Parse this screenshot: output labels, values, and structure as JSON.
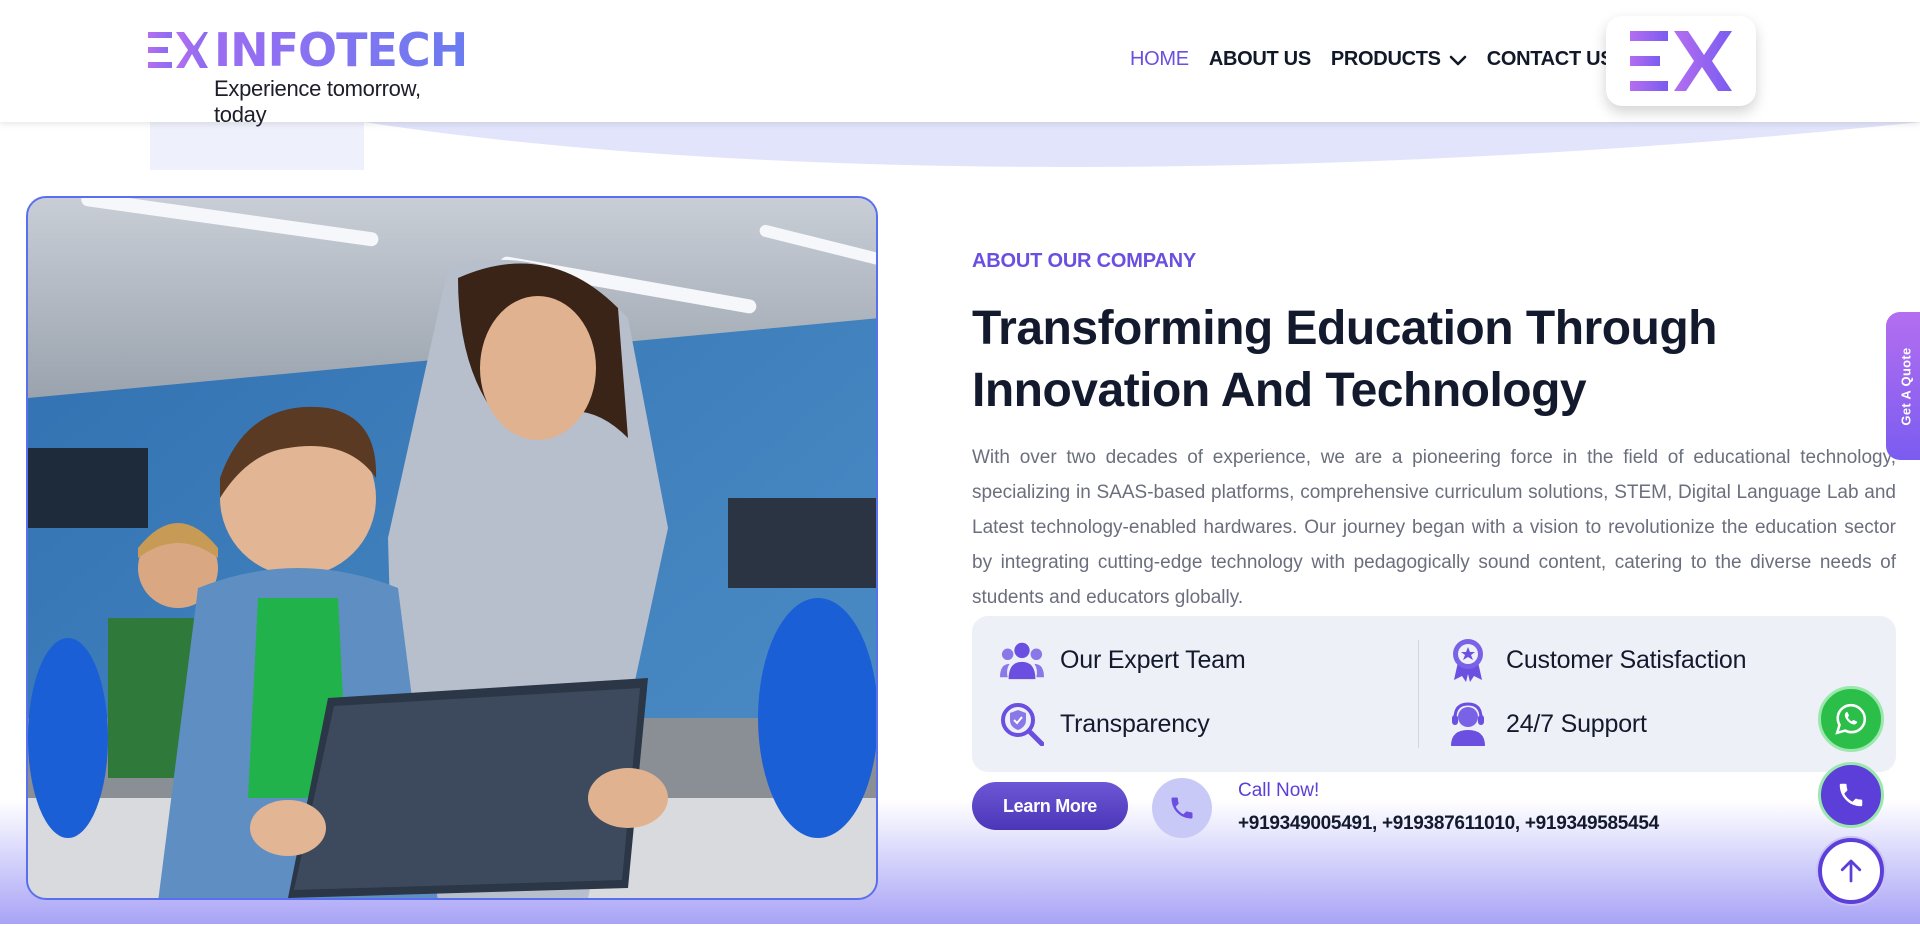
{
  "brand": {
    "name": "INFOTECH",
    "tagline": "Experience tomorrow, today",
    "colors": {
      "primary": "#6a4fe0",
      "accent_gradient_start": "#b46ef0",
      "accent_gradient_end": "#6a7cf0",
      "dark": "#141a2e"
    }
  },
  "nav": {
    "items": [
      {
        "label": "HOME",
        "active": true
      },
      {
        "label": "ABOUT US",
        "active": false
      },
      {
        "label": "PRODUCTS",
        "active": false,
        "has_dropdown": true
      },
      {
        "label": "CONTACT US",
        "active": false
      }
    ]
  },
  "about": {
    "eyebrow": "ABOUT OUR COMPANY",
    "headline_line1": "Transforming Education Through",
    "headline_line2": "Innovation And Technology",
    "paragraph": "With over two decades of experience, we are a pioneering force in the field of educational technology, specializing in SAAS-based platforms, comprehensive curriculum solutions, STEM, Digital Language Lab and Latest technology-enabled hardwares. Our journey began with a vision to revolutionize the education sector by integrating cutting-edge technology with pedagogically sound content, catering to the diverse needs of students and educators globally.",
    "features": [
      {
        "label": "Our Expert Team",
        "icon": "team-icon"
      },
      {
        "label": "Customer Satisfaction",
        "icon": "award-ribbon-icon"
      },
      {
        "label": "Transparency",
        "icon": "shield-search-icon"
      },
      {
        "label": "24/7 Support",
        "icon": "support-agent-icon"
      }
    ],
    "learn_more_label": "Learn More",
    "call_label": "Call Now!",
    "call_numbers": "+919349005491, +919387611010, +919349585454"
  },
  "side_tab": {
    "label": "Get A Quote"
  },
  "floating": {
    "whatsapp_icon": "whatsapp-icon",
    "phone_icon": "phone-icon",
    "top_icon": "arrow-up-icon"
  }
}
